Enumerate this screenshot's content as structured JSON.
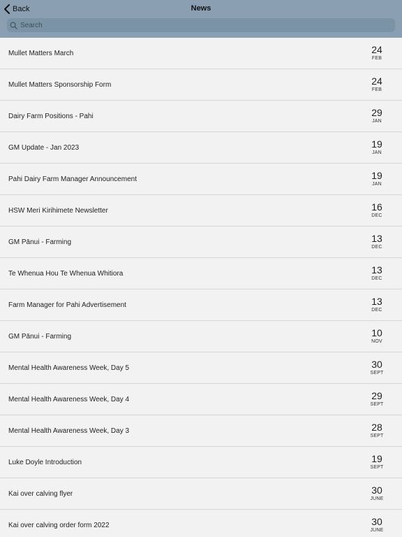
{
  "header": {
    "back_label": "Back",
    "title": "News",
    "search_placeholder": "Search",
    "background_color": "#8aa0b2"
  },
  "news": [
    {
      "title": "Mullet Matters March",
      "day": "24",
      "month": "FEB"
    },
    {
      "title": "Mullet Matters Sponsorship Form",
      "day": "24",
      "month": "FEB"
    },
    {
      "title": "Dairy Farm Positions - Pahi",
      "day": "29",
      "month": "JAN"
    },
    {
      "title": "GM Update - Jan 2023",
      "day": "19",
      "month": "JAN"
    },
    {
      "title": "Pahi Dairy Farm Manager Announcement",
      "day": "19",
      "month": "JAN"
    },
    {
      "title": "HSW Meri Kirihimete Newsletter",
      "day": "16",
      "month": "DEC"
    },
    {
      "title": "GM Pānui - Farming",
      "day": "13",
      "month": "DEC"
    },
    {
      "title": "Te Whenua Hou Te Whenua Whitiora",
      "day": "13",
      "month": "DEC"
    },
    {
      "title": "Farm Manager for Pahi Advertisement",
      "day": "13",
      "month": "DEC"
    },
    {
      "title": "GM Pānui - Farming",
      "day": "10",
      "month": "NOV"
    },
    {
      "title": "Mental Health Awareness Week, Day 5",
      "day": "30",
      "month": "SEPT"
    },
    {
      "title": "Mental Health Awareness Week, Day 4",
      "day": "29",
      "month": "SEPT"
    },
    {
      "title": "Mental Health Awareness Week, Day 3",
      "day": "28",
      "month": "SEPT"
    },
    {
      "title": "Luke Doyle Introduction",
      "day": "19",
      "month": "SEPT"
    },
    {
      "title": "Kai over calving flyer",
      "day": "30",
      "month": "JUNE"
    },
    {
      "title": "Kai over calving order form 2022",
      "day": "30",
      "month": "JUNE"
    }
  ]
}
